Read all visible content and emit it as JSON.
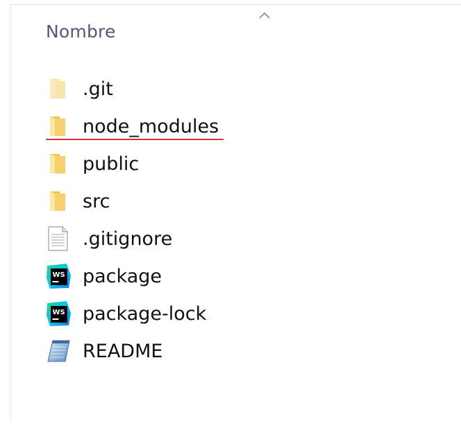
{
  "header": {
    "column_label": "Nombre",
    "sort_icon": "chevron-up-icon"
  },
  "files": [
    {
      "name": ".git",
      "icon": "folder-pale-icon",
      "type": "folder"
    },
    {
      "name": "node_modules",
      "icon": "folder-icon",
      "type": "folder",
      "highlighted": true
    },
    {
      "name": "public",
      "icon": "folder-icon",
      "type": "folder"
    },
    {
      "name": "src",
      "icon": "folder-icon",
      "type": "folder"
    },
    {
      "name": ".gitignore",
      "icon": "text-file-icon",
      "type": "file"
    },
    {
      "name": "package",
      "icon": "webstorm-icon",
      "type": "file"
    },
    {
      "name": "package-lock",
      "icon": "webstorm-icon",
      "type": "file"
    },
    {
      "name": "README",
      "icon": "notepad-icon",
      "type": "file"
    }
  ],
  "colors": {
    "highlight": "#e03030",
    "header_text": "#4f5b73",
    "folder": "#f4c94f"
  }
}
